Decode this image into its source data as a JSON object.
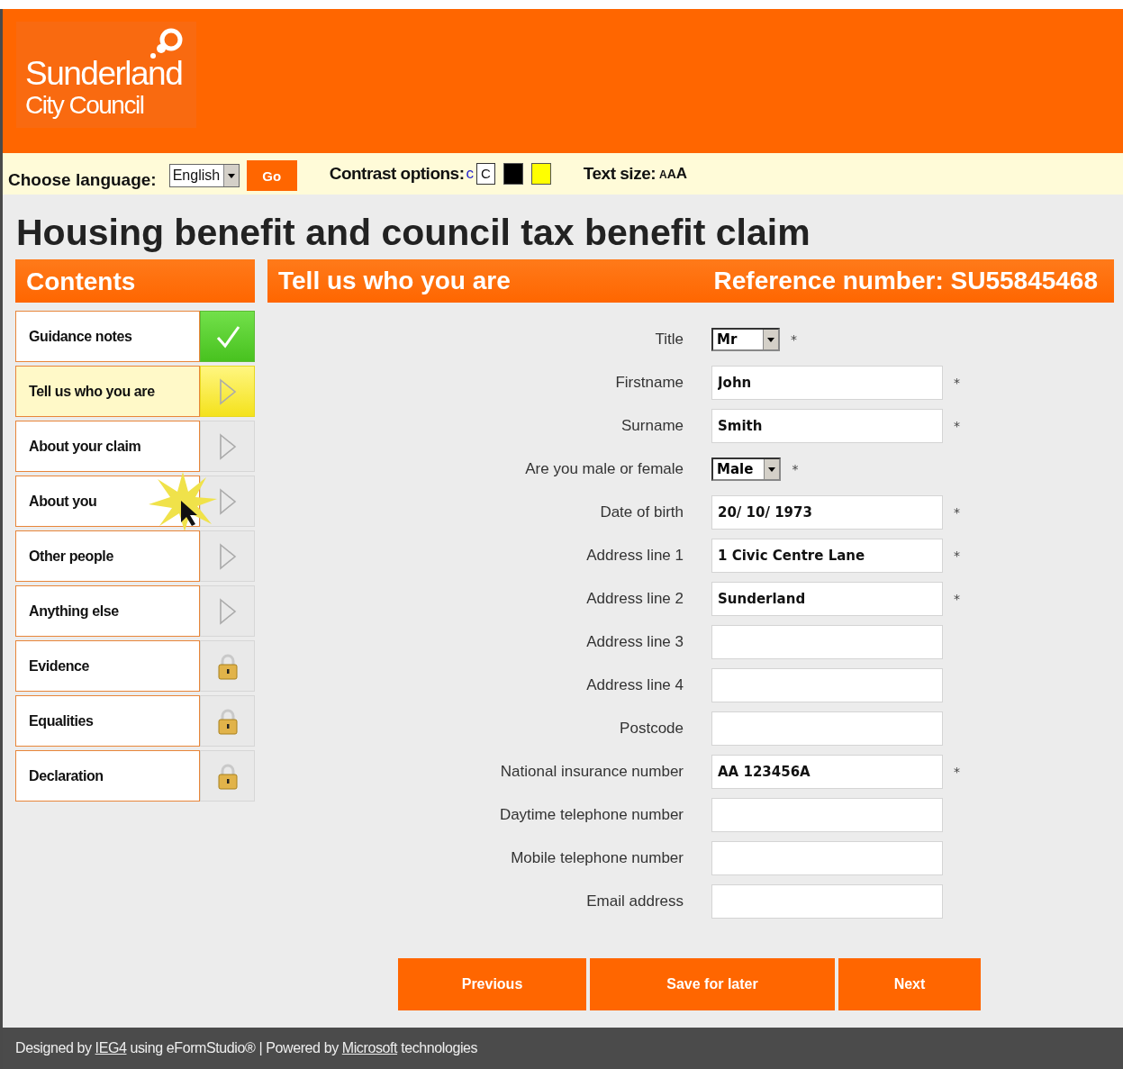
{
  "header": {
    "logo": {
      "line_1": "Sunderland",
      "line_2": "City Council"
    }
  },
  "toolbar": {
    "language_label": "Choose language:",
    "language": "English",
    "go_button": "Go",
    "contrast_label": "Contrast options:",
    "contrast_options": [
      {
        "kind": "link",
        "text": "c"
      },
      {
        "kind": "boxed",
        "text": "C"
      },
      {
        "kind": "swatch",
        "color": "#000000"
      },
      {
        "kind": "swatch",
        "color": "#ffff00"
      }
    ],
    "text_size_label": "Text size:",
    "text_sizes": [
      "A",
      "A",
      "A"
    ]
  },
  "page_title": "Housing benefit and council tax benefit claim",
  "sidebar": {
    "title": "Contents",
    "items": [
      {
        "label": "Guidance notes",
        "kind": "done",
        "selected": false
      },
      {
        "label": "Tell us who you are",
        "kind": "current",
        "selected": true
      },
      {
        "label": "About your claim",
        "kind": "open",
        "selected": false
      },
      {
        "label": "About you",
        "kind": "open",
        "selected": false
      },
      {
        "label": "Other people",
        "kind": "open",
        "selected": false
      },
      {
        "label": "Anything else",
        "kind": "open",
        "selected": false
      },
      {
        "label": "Evidence",
        "kind": "locked",
        "selected": false
      },
      {
        "label": "Equalities",
        "kind": "locked",
        "selected": false
      },
      {
        "label": "Declaration",
        "kind": "locked",
        "selected": false
      }
    ]
  },
  "section": {
    "title": "Tell us who you are",
    "reference": "Reference number: SU55845468"
  },
  "fields": [
    {
      "label": "Title",
      "kind": "select",
      "value": "Mr",
      "required": true
    },
    {
      "label": "Firstname",
      "kind": "text",
      "value": "John",
      "required": true
    },
    {
      "label": "Surname",
      "kind": "text",
      "value": "Smith",
      "required": true
    },
    {
      "label": "Are you male or female",
      "kind": "select",
      "value": "Male",
      "required": true
    },
    {
      "label": "Date of birth",
      "kind": "text",
      "value": "20/ 10/ 1973",
      "required": true
    },
    {
      "label": "Address line 1",
      "kind": "text",
      "value": "1 Civic Centre Lane",
      "required": true
    },
    {
      "label": "Address line 2",
      "kind": "text",
      "value": "Sunderland",
      "required": true
    },
    {
      "label": "Address line 3",
      "kind": "text",
      "required": false
    },
    {
      "label": "Address line 4",
      "kind": "text",
      "required": false
    },
    {
      "label": "Postcode",
      "kind": "text",
      "required": false
    },
    {
      "label": "National insurance number",
      "kind": "text",
      "value": "AA 123456A",
      "required": true
    },
    {
      "label": "Daytime telephone number",
      "kind": "text",
      "required": false
    },
    {
      "label": "Mobile telephone number",
      "kind": "text",
      "required": false
    },
    {
      "label": "Email address",
      "kind": "text",
      "required": false
    }
  ],
  "required_mark": "*",
  "buttons": [
    {
      "label": "Previous",
      "kind": "previous"
    },
    {
      "label": "Save for later",
      "kind": "save"
    },
    {
      "label": "Next",
      "kind": "next"
    }
  ],
  "footer": [
    {
      "kind": "text",
      "text": "Designed by"
    },
    {
      "kind": "link",
      "text": "IEG4"
    },
    {
      "kind": "text",
      "text": "using eFormStudio® | Powered by"
    },
    {
      "kind": "link",
      "text": "Microsoft"
    },
    {
      "kind": "text",
      "text": "technologies"
    }
  ]
}
